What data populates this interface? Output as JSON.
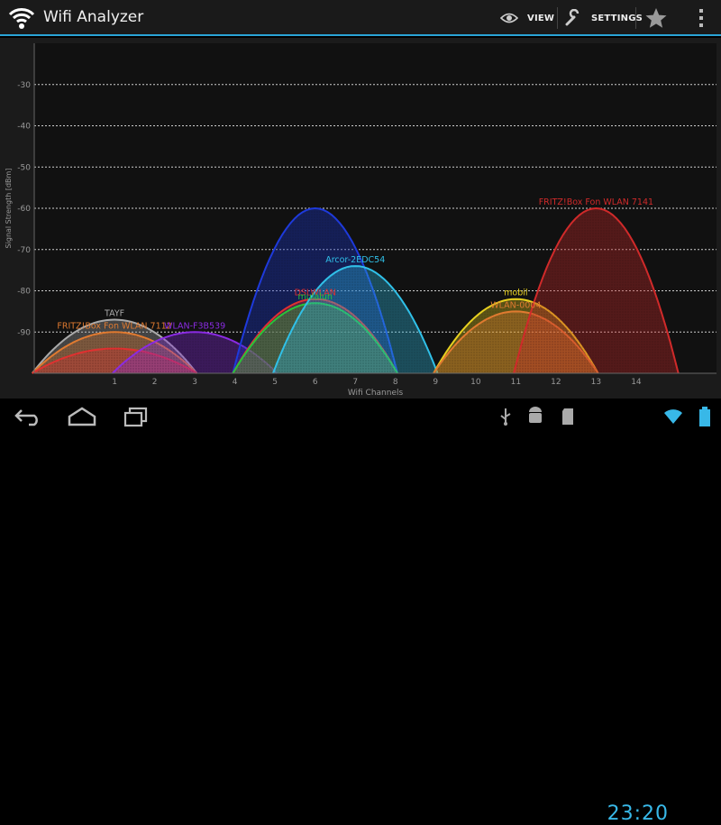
{
  "app": {
    "title": "Wifi Analyzer",
    "actions": {
      "view_label": "VIEW",
      "settings_label": "SETTINGS"
    },
    "icons": {
      "app": "wifi-icon",
      "view": "eye-icon",
      "settings": "wrench-icon",
      "favorite": "star-icon",
      "overflow": "more-vertical-icon"
    }
  },
  "chart_data": {
    "type": "area",
    "xlabel": "Wifi Channels",
    "ylabel": "Signal Strength [dBm]",
    "x_ticks": [
      1,
      2,
      3,
      4,
      5,
      6,
      7,
      8,
      9,
      10,
      11,
      12,
      13,
      14
    ],
    "y_ticks": [
      -30,
      -40,
      -50,
      -60,
      -70,
      -80,
      -90
    ],
    "xlim": [
      -1,
      16
    ],
    "ylim": [
      -100,
      -20
    ],
    "grid": true,
    "networks": [
      {
        "ssid": "TAYF",
        "channel": 1,
        "level": -87,
        "color": "#aaaaaa"
      },
      {
        "ssid": "FRITZ!Box Fon WLAN 7112",
        "channel": 1,
        "level": -90,
        "color": "#e07a30"
      },
      {
        "ssid": "",
        "channel": 1,
        "level": -94,
        "color": "#e03030"
      },
      {
        "ssid": "WLAN-F3B539",
        "channel": 3,
        "level": -90,
        "color": "#8a2be2"
      },
      {
        "ssid": "",
        "channel": 6,
        "level": -60,
        "color": "#1e3adb"
      },
      {
        "ssid": "DSLWLAN",
        "channel": 6,
        "level": -82,
        "color": "#e03030"
      },
      {
        "ssid": "mulalun",
        "channel": 6,
        "level": -83,
        "color": "#28c43a"
      },
      {
        "ssid": "Arcor-2EDC54",
        "channel": 7,
        "level": -74,
        "color": "#30c0e8"
      },
      {
        "ssid": "mobil",
        "channel": 11,
        "level": -82,
        "color": "#e8d020"
      },
      {
        "ssid": "WLAN-0004",
        "channel": 11,
        "level": -85,
        "color": "#e07a30"
      },
      {
        "ssid": "FRITZ!Box Fon WLAN 7141",
        "channel": 13,
        "level": -60,
        "color": "#d02a2a"
      }
    ]
  },
  "status_bar": {
    "time": "23:20"
  },
  "nav_icons": {
    "back": "back-icon",
    "home": "home-icon",
    "recent": "recent-apps-icon",
    "usb": "usb-icon",
    "android": "android-debug-icon",
    "sd": "sd-card-icon",
    "wifi": "wifi-signal-icon",
    "battery": "battery-icon"
  }
}
